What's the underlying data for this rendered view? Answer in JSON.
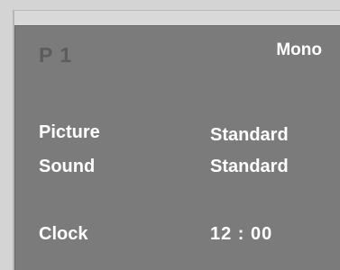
{
  "osd": {
    "channel": "P 1",
    "audio_mode": "Mono",
    "rows": [
      {
        "label": "Picture",
        "value": "Standard"
      },
      {
        "label": "Sound",
        "value": "Standard"
      },
      {
        "label": "Clock",
        "value": "12 : 00"
      }
    ]
  }
}
